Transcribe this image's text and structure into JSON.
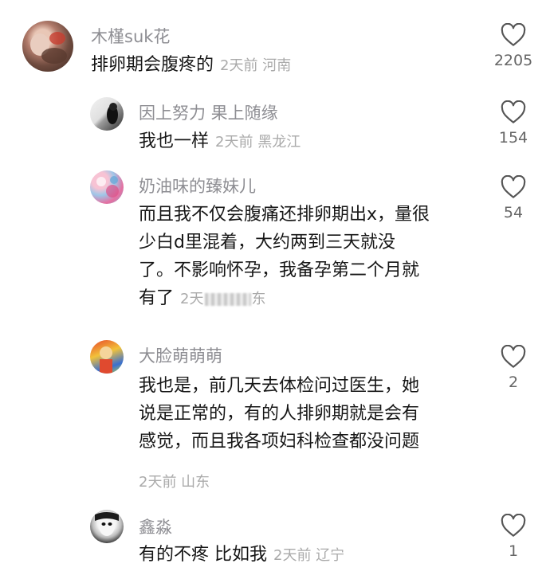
{
  "comments": [
    {
      "name": "木槿suk花",
      "text": "排卵期会腹疼的",
      "meta": "2天前 河南",
      "likes": "2205"
    },
    {
      "name": "因上努力 果上随缘",
      "text": "我也一样",
      "meta": "2天前 黑龙江",
      "likes": "154"
    },
    {
      "name": "奶油味的臻妹儿",
      "text_lines": [
        "而且我不仅会腹痛还排卵期出x，量很",
        "少白d里混着，大约两到三天就没",
        "了。不影响怀孕，我备孕第二个月就",
        "有了"
      ],
      "meta": "2天",
      "meta_tail": "东",
      "likes": "54"
    },
    {
      "name": "大脸萌萌萌",
      "text_lines": [
        "我也是，前几天去体检问过医生，她",
        "说是正常的，有的人排卵期就是会有",
        "感觉，而且我各项妇科检查都没问题"
      ],
      "meta": "2天前 山东",
      "likes": "2"
    },
    {
      "name": "鑫淼",
      "text": "有的不疼 比如我",
      "meta": "2天前 辽宁",
      "likes": "1"
    }
  ],
  "icons": {
    "like": "heart-outline-icon"
  },
  "colors": {
    "name": "#8e8e93",
    "text": "#161616",
    "meta": "#aaaaaa",
    "count": "#666666"
  }
}
